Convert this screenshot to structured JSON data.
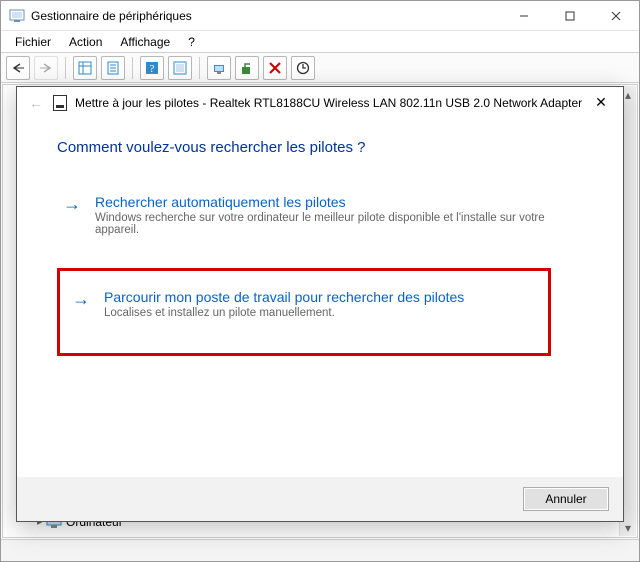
{
  "window": {
    "title": "Gestionnaire de périphériques"
  },
  "menu": {
    "file": "Fichier",
    "action": "Action",
    "view": "Affichage",
    "help": "?"
  },
  "tree": {
    "item_computer": "Ordinateur"
  },
  "dialog": {
    "title": "Mettre à jour les pilotes - Realtek RTL8188CU Wireless LAN 802.11n USB 2.0 Network Adapter",
    "question": "Comment voulez-vous rechercher les pilotes ?",
    "option1": {
      "title": "Rechercher automatiquement les pilotes",
      "desc": "Windows recherche sur votre ordinateur le meilleur pilote disponible et l'installe sur votre appareil."
    },
    "option2": {
      "title": "Parcourir mon poste de travail pour rechercher des pilotes",
      "desc": "Localises et installez un pilote manuellement."
    },
    "cancel": "Annuler"
  }
}
